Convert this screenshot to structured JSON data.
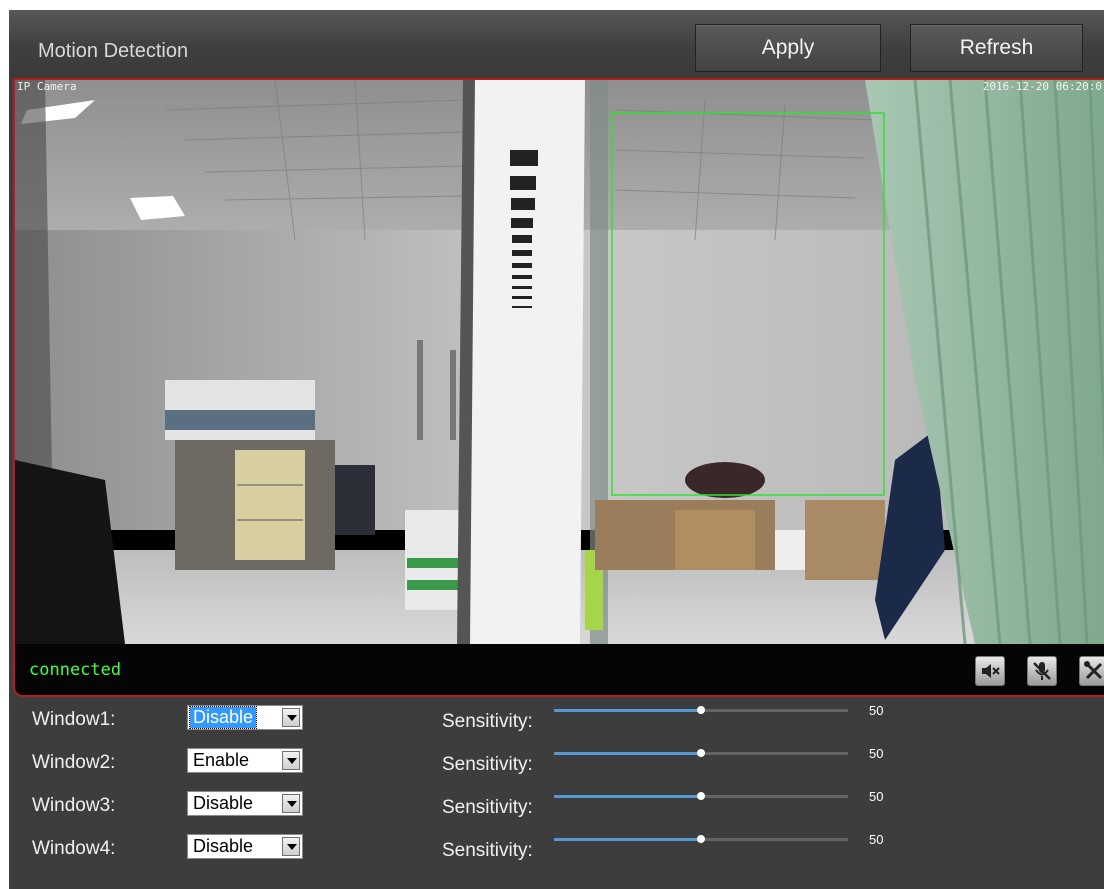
{
  "header": {
    "title": "Motion Detection",
    "apply_label": "Apply",
    "refresh_label": "Refresh"
  },
  "video": {
    "camera_label": "IP Camera",
    "timestamp": "2016-12-20 06:20:0",
    "status": "connected",
    "controls": [
      {
        "icon": "speaker-mute-icon"
      },
      {
        "icon": "microphone-mute-icon"
      },
      {
        "icon": "tools-icon"
      }
    ]
  },
  "windows": [
    {
      "label": "Window1:",
      "state": "Disable",
      "sensitivity_label": "Sensitivity:",
      "sensitivity": 50
    },
    {
      "label": "Window2:",
      "state": "Enable",
      "sensitivity_label": "Sensitivity:",
      "sensitivity": 50
    },
    {
      "label": "Window3:",
      "state": "Disable",
      "sensitivity_label": "Sensitivity:",
      "sensitivity": 50
    },
    {
      "label": "Window4:",
      "state": "Disable",
      "sensitivity_label": "Sensitivity:",
      "sensitivity": 50
    }
  ],
  "colors": {
    "border_red": "#b31f1f",
    "status_green": "#43ff43",
    "slider_blue": "#5598d2",
    "detect_box_green": "#2fe22f"
  }
}
